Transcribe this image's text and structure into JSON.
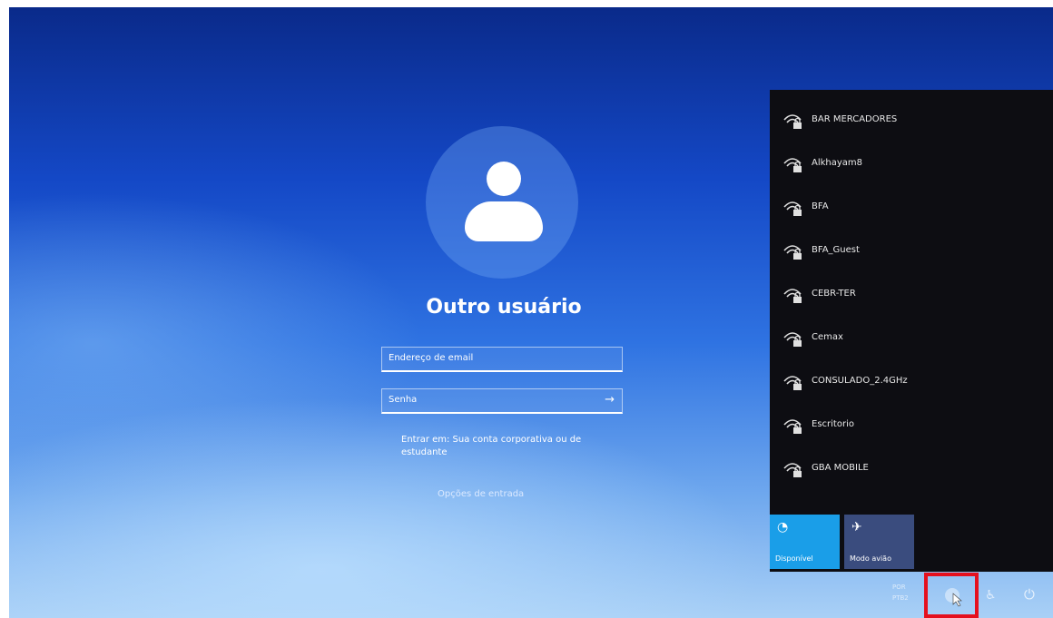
{
  "login": {
    "user_name": "Outro usuário",
    "email_placeholder": "Endereço de email",
    "password_placeholder": "Senha",
    "submit_arrow": "→",
    "signin_hint": "Entrar em: Sua conta corporativa ou de estudante",
    "signin_options": "Opções de entrada"
  },
  "wifi_panel": {
    "networks": [
      {
        "name": "BAR MERCADORES",
        "secured": true
      },
      {
        "name": "Alkhayam8",
        "secured": true
      },
      {
        "name": "BFA",
        "secured": true
      },
      {
        "name": "BFA_Guest",
        "secured": true
      },
      {
        "name": "CEBR-TER",
        "secured": true
      },
      {
        "name": "Cemax",
        "secured": true
      },
      {
        "name": "CONSULADO_2.4GHz",
        "secured": true
      },
      {
        "name": "Escritorio",
        "secured": true
      },
      {
        "name": "GBA MOBILE",
        "secured": true
      }
    ],
    "tiles": {
      "wifi_label": "Disponível",
      "airplane_label": "Modo avião"
    }
  },
  "taskbar": {
    "lang_line1": "POR",
    "lang_line2": "PTB2",
    "icons": [
      "network-icon",
      "accessibility-icon",
      "power-icon"
    ]
  },
  "colors": {
    "wifi_tile": "#1a9ee8",
    "airplane_tile": "#3a4c7e",
    "panel_bg": "#0d0d12",
    "highlight": "#e5101e"
  }
}
